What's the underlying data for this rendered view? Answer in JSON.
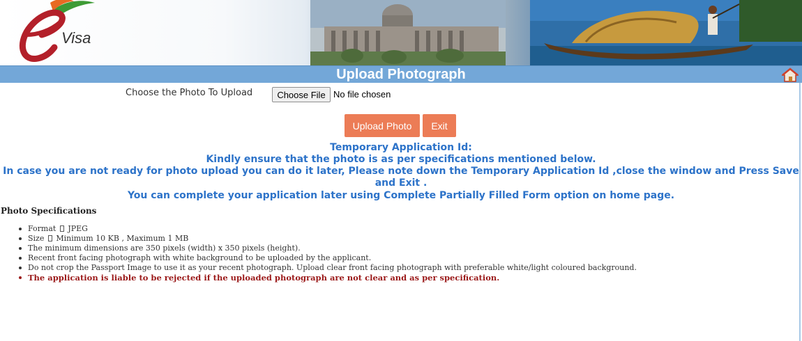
{
  "banner": {
    "logo_text": "Visa",
    "logo_letter": "e"
  },
  "header": {
    "title": "Upload Photograph",
    "home_icon": "home-icon"
  },
  "upload": {
    "label": "Choose the Photo To Upload",
    "choose_button": "Choose File",
    "file_status": "No file chosen",
    "upload_button": "Upload Photo",
    "exit_button": "Exit"
  },
  "notices": {
    "line1": "Temporary Application Id:",
    "line2": "Kindly ensure that the photo is as per specifications mentioned below.",
    "line3": "In case you are not ready for photo upload you can do it later, Please note down the Temporary Application Id ,close the window and Press Save and Exit .",
    "line4": "You can complete your application later using Complete Partially Filled Form option on home page."
  },
  "specs": {
    "title": "Photo Specifications",
    "format_label": "Format",
    "format_value": "JPEG",
    "size_label": "Size",
    "size_value": "Minimum 10 KB , Maximum 1 MB",
    "items": [
      "The minimum dimensions are 350 pixels (width) x 350 pixels (height).",
      "Recent front facing photograph with white background to be uploaded by the applicant.",
      "Do not crop the Passport Image to use it as your recent photograph. Upload clear front facing photograph with preferable white/light coloured background."
    ],
    "warning": "The application is liable to be rejected if the uploaded photograph are not clear and as per specification."
  },
  "colors": {
    "title_bar": "#73a7d8",
    "button": "#ec7c56",
    "notice_text": "#2d73c9",
    "warning_text": "#9b1a1a"
  }
}
